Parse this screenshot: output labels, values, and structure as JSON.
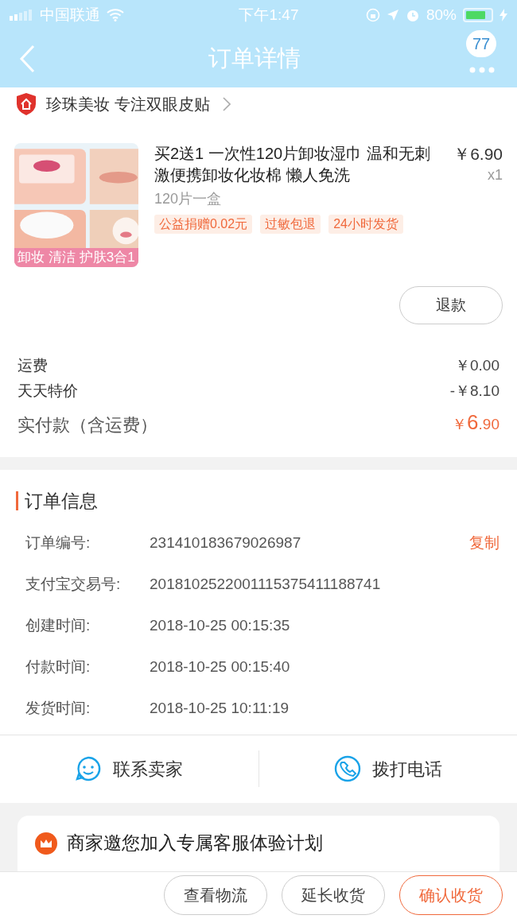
{
  "status_bar": {
    "carrier": "中国联通",
    "time": "下午1:47",
    "battery_text": "80%"
  },
  "nav": {
    "title": "订单详情",
    "badge": "77"
  },
  "shop": {
    "name": "珍珠美妆 专注双眼皮贴"
  },
  "product": {
    "image": {
      "kind": "picture",
      "caption": "卸妆 清洁 护肤3合1"
    },
    "title": "买2送1 一次性120片卸妆湿巾 温和无刺激便携卸妆化妆棉 懒人免洗",
    "price": "￥6.90",
    "quantity": "x1",
    "variant": "120片一盒",
    "tags": [
      "公益捐赠0.02元",
      "过敏包退",
      "24小时发货"
    ],
    "action": "退款"
  },
  "fees": [
    {
      "label": "运费",
      "value": "￥0.00"
    },
    {
      "label": "天天特价",
      "value": "-￥8.10"
    }
  ],
  "total": {
    "label": "实付款（含运费）",
    "currency": "￥",
    "integer": "6",
    "decimal": ".90"
  },
  "order_info": {
    "title": "订单信息",
    "rows": [
      {
        "label": "订单编号:",
        "value": "231410183679026987",
        "action": "复制"
      },
      {
        "label": "支付宝交易号:",
        "value": "2018102522001115375411188741"
      },
      {
        "label": "创建时间:",
        "value": "2018-10-25 00:15:35"
      },
      {
        "label": "付款时间:",
        "value": "2018-10-25 00:15:40"
      },
      {
        "label": "发货时间:",
        "value": "2018-10-25 10:11:19"
      }
    ]
  },
  "contact": [
    {
      "kind": "chat",
      "label": "联系卖家"
    },
    {
      "kind": "phone",
      "label": "拨打电话"
    }
  ],
  "promo": {
    "text": "商家邀您加入专属客服体验计划"
  },
  "bottom_buttons": [
    {
      "label": "查看物流",
      "primary": false
    },
    {
      "label": "延长收货",
      "primary": false
    },
    {
      "label": "确认收货",
      "primary": true
    }
  ]
}
